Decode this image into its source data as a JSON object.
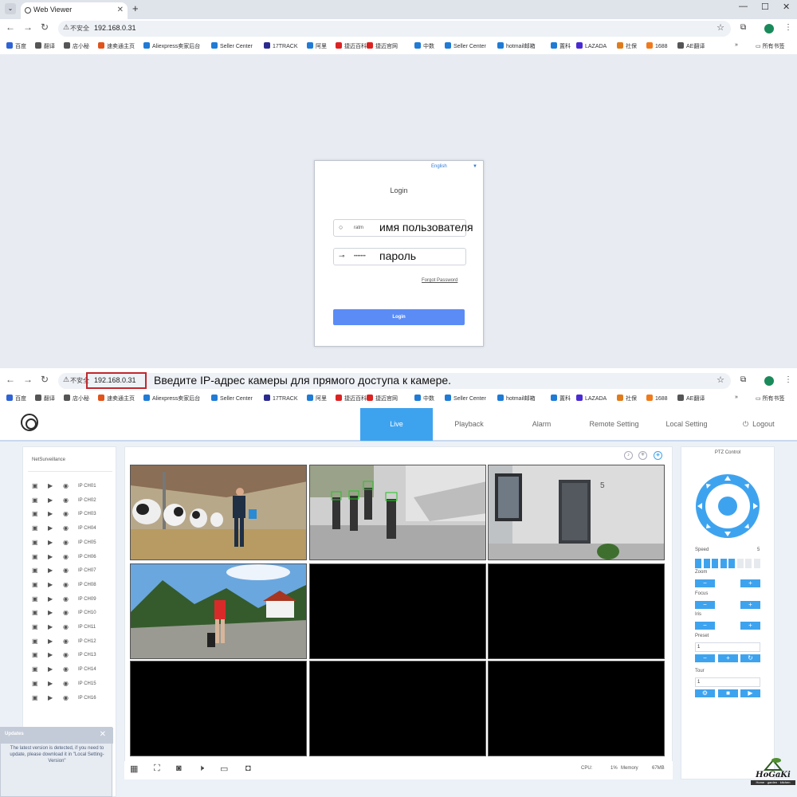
{
  "browser": {
    "tab_title": "Web Viewer",
    "new_tab": "+",
    "not_secure": "不安全",
    "url": "192.168.0.31",
    "window_controls": [
      "—",
      "☐",
      "✕"
    ],
    "bookmarks": [
      "百度",
      "翻译",
      "店小秘",
      "速卖通主页",
      "Aliexpress卖家后台",
      "Seller Center",
      "17TRACK",
      "阿里",
      "捷迈百科",
      "捷迈官网",
      "中数",
      "Seller Center",
      "hotmail邮箱",
      "置科",
      "LAZADA",
      "社保",
      "1688",
      "AE翻译"
    ],
    "all_bookmarks": "所有书签",
    "more_bookmarks": "»"
  },
  "login": {
    "language": "English",
    "title": "Login",
    "username_value": "ratm",
    "password_value": "•••••••",
    "forgot": "Forgot Password",
    "button": "Login"
  },
  "annotations": {
    "username": "имя пользователя",
    "password": "пароль",
    "address": "Введите IP-адрес камеры для прямого доступа к камере."
  },
  "nvr": {
    "tabs": [
      "Live",
      "Playback",
      "Alarm",
      "Remote Setting",
      "Local Setting"
    ],
    "active_tab": "Live",
    "logout": "Logout",
    "tree_title": "NetSurveillance",
    "channels": [
      "IP CH01",
      "IP CH02",
      "IP CH03",
      "IP CH04",
      "IP CH05",
      "IP CH06",
      "IP CH07",
      "IP CH08",
      "IP CH09",
      "IP CH10",
      "IP CH11",
      "IP CH12",
      "IP CH13",
      "IP CH14",
      "IP CH15",
      "IP CH16"
    ],
    "status": {
      "cpu_label": "CPU:",
      "cpu_value": "1%",
      "memory_label": "Memory",
      "memory_value": "67MB"
    },
    "ptz": {
      "title": "PTZ Control",
      "speed_label": "Speed",
      "speed_value": "5",
      "speed_level": 5,
      "speed_max": 8,
      "zoom": "Zoom",
      "focus": "Focus",
      "iris": "Iris",
      "preset": "Preset",
      "preset_value": "1",
      "tour": "Tour",
      "tour_value": "1"
    },
    "updates": {
      "title": "Updates",
      "message": "The latest version is detected, if you need to update, please download it in \"Local Setting-Version\""
    }
  },
  "watermark": {
    "brand": "HoGaKi",
    "tagline": "Home · garden · kitchen"
  },
  "colors": {
    "accent": "#3ea3ef",
    "login_button": "#5b8cf6",
    "highlight_box": "#c0282e"
  }
}
